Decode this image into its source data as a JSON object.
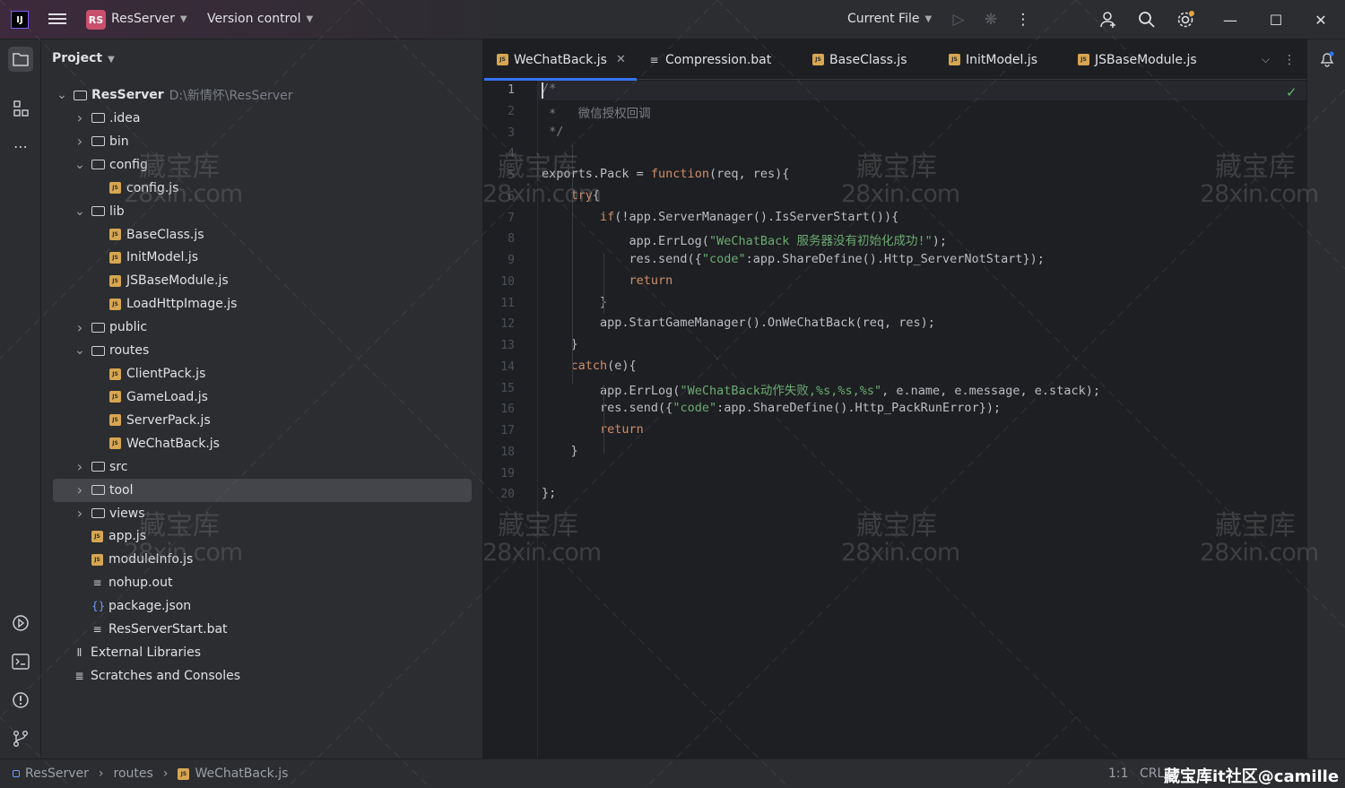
{
  "titlebar": {
    "project_initials": "RS",
    "project_name": "ResServer",
    "vcs_label": "Version control",
    "run_config": "Current File"
  },
  "project_panel": {
    "header": "Project",
    "tree": [
      {
        "label": "ResServer",
        "path": "D:\\新情怀\\ResServer",
        "type": "root",
        "depth": 0,
        "expanded": true
      },
      {
        "label": ".idea",
        "type": "folder",
        "depth": 1,
        "expanded": false
      },
      {
        "label": "bin",
        "type": "folder",
        "depth": 1,
        "expanded": false
      },
      {
        "label": "config",
        "type": "folder",
        "depth": 1,
        "expanded": true
      },
      {
        "label": "config.js",
        "type": "js",
        "depth": 2
      },
      {
        "label": "lib",
        "type": "folder",
        "depth": 1,
        "expanded": true
      },
      {
        "label": "BaseClass.js",
        "type": "js",
        "depth": 2
      },
      {
        "label": "InitModel.js",
        "type": "js",
        "depth": 2
      },
      {
        "label": "JSBaseModule.js",
        "type": "js",
        "depth": 2
      },
      {
        "label": "LoadHttpImage.js",
        "type": "js",
        "depth": 2
      },
      {
        "label": "public",
        "type": "folder",
        "depth": 1,
        "expanded": false
      },
      {
        "label": "routes",
        "type": "folder",
        "depth": 1,
        "expanded": true
      },
      {
        "label": "ClientPack.js",
        "type": "js",
        "depth": 2
      },
      {
        "label": "GameLoad.js",
        "type": "js",
        "depth": 2
      },
      {
        "label": "ServerPack.js",
        "type": "js",
        "depth": 2
      },
      {
        "label": "WeChatBack.js",
        "type": "js",
        "depth": 2
      },
      {
        "label": "src",
        "type": "folder",
        "depth": 1,
        "expanded": false
      },
      {
        "label": "tool",
        "type": "folder",
        "depth": 1,
        "expanded": false,
        "selected": true
      },
      {
        "label": "views",
        "type": "folder",
        "depth": 1,
        "expanded": false
      },
      {
        "label": "app.js",
        "type": "js",
        "depth": 1
      },
      {
        "label": "moduleInfo.js",
        "type": "js",
        "depth": 1
      },
      {
        "label": "nohup.out",
        "type": "text",
        "depth": 1
      },
      {
        "label": "package.json",
        "type": "json",
        "depth": 1
      },
      {
        "label": "ResServerStart.bat",
        "type": "text",
        "depth": 1
      },
      {
        "label": "External Libraries",
        "type": "lib",
        "depth": 0
      },
      {
        "label": "Scratches and Consoles",
        "type": "scratch",
        "depth": 0
      }
    ]
  },
  "tabs": [
    {
      "label": "WeChatBack.js",
      "type": "js",
      "active": true
    },
    {
      "label": "Compression.bat",
      "type": "text"
    },
    {
      "label": "BaseClass.js",
      "type": "js"
    },
    {
      "label": "InitModel.js",
      "type": "js"
    },
    {
      "label": "JSBaseModule.js",
      "type": "js"
    }
  ],
  "code_lines": [
    "/*",
    " *   微信授权回调",
    " */",
    "",
    "exports.Pack = function(req, res){",
    "    try{",
    "        if(!app.ServerManager().IsServerStart()){",
    "            app.ErrLog(\"WeChatBack 服务器没有初始化成功!\");",
    "            res.send({\"code\":app.ShareDefine().Http_ServerNotStart});",
    "            return",
    "        }",
    "        app.StartGameManager().OnWeChatBack(req, res);",
    "    }",
    "    catch(e){",
    "        app.ErrLog(\"WeChatBack动作失败,%s,%s,%s\", e.name, e.message, e.stack);",
    "        res.send({\"code\":app.ShareDefine().Http_PackRunError});",
    "        return",
    "    }",
    "",
    "};"
  ],
  "line_numbers": [
    "1",
    "2",
    "3",
    "4",
    "5",
    "6",
    "7",
    "8",
    "9",
    "10",
    "11",
    "12",
    "13",
    "14",
    "15",
    "16",
    "17",
    "18",
    "19",
    "20"
  ],
  "statusbar": {
    "crumbs": [
      "ResServer",
      "routes",
      "WeChatBack.js"
    ],
    "position": "1:1",
    "line_sep": "CRLF",
    "overlay_text": "藏宝库it社区@camille"
  },
  "watermark": {
    "line1": "藏宝库",
    "line2": "28xin.com"
  },
  "colors": {
    "accent": "#3574f0",
    "js_icon": "#d7a650",
    "project_badge": "#c94f6d",
    "keyword": "#cf8e6d",
    "string": "#6aab73",
    "comment": "#7a7e85"
  }
}
